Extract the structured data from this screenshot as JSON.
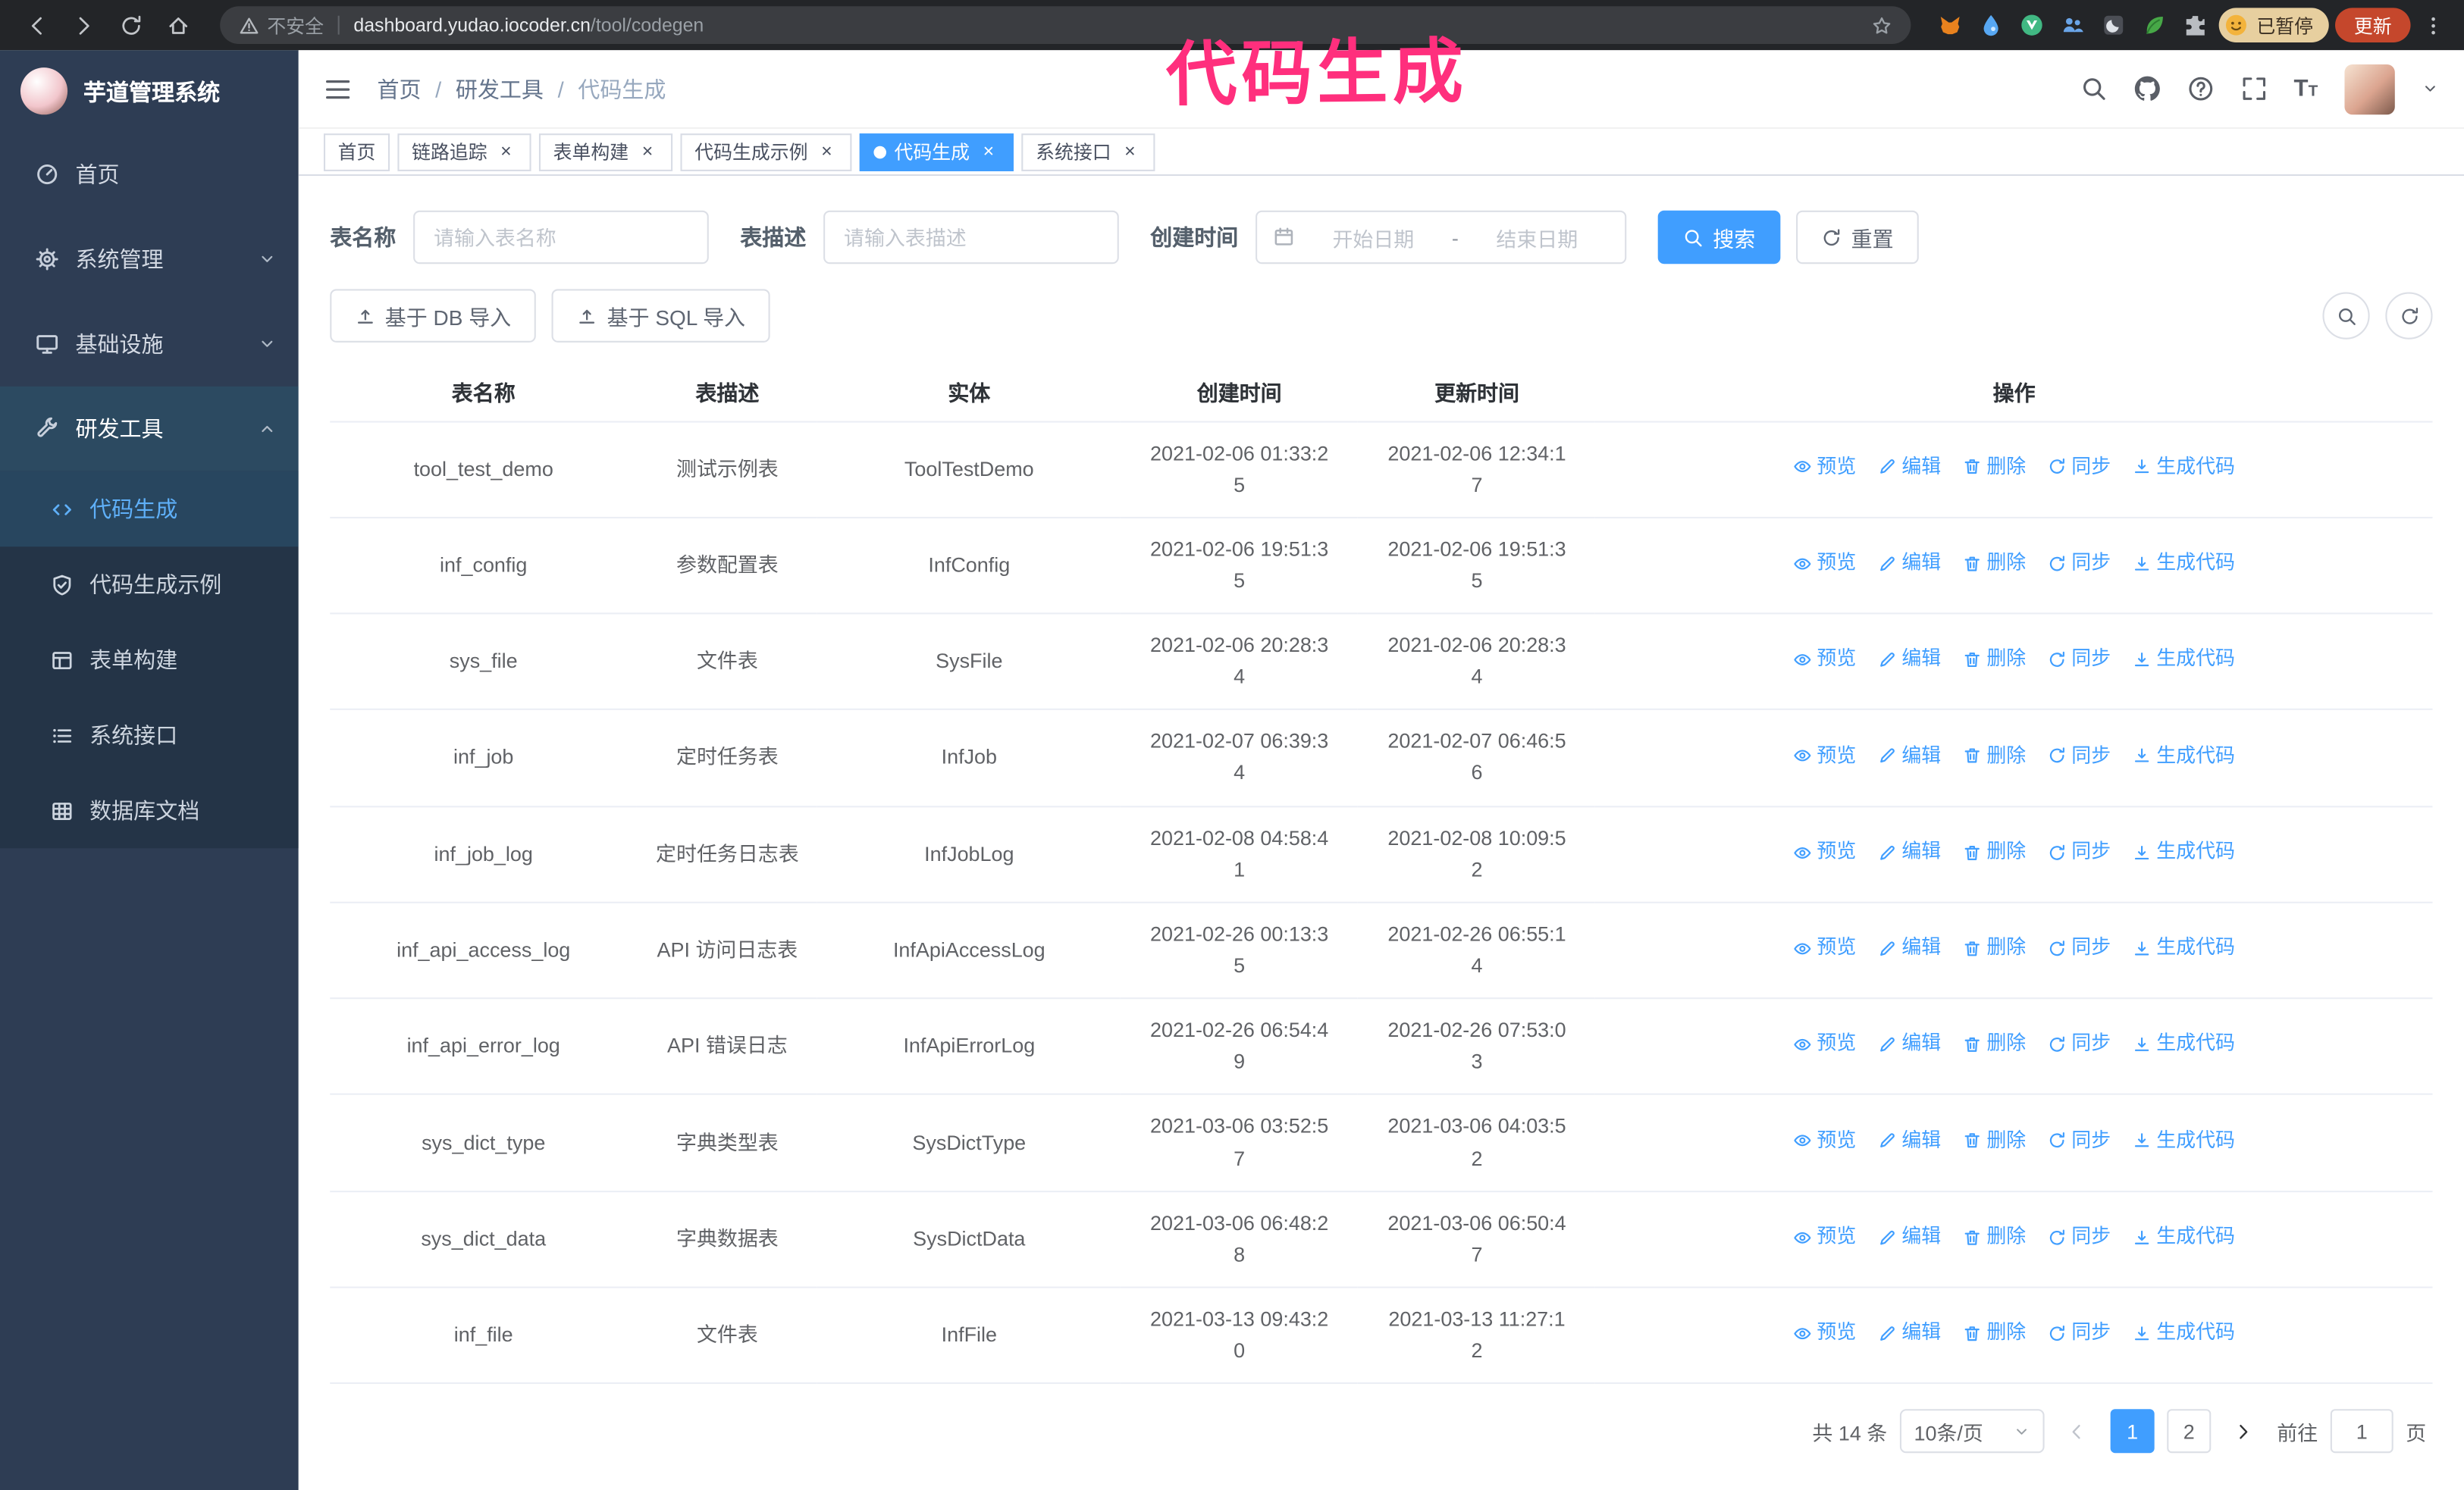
{
  "annotation": {
    "text": "代码生成",
    "color": "#ff2f7d"
  },
  "browser": {
    "security_label": "不安全",
    "url_host": "dashboard.yudao.iocoder.cn",
    "url_path": "/tool/codegen",
    "paused_badge": "已暂停",
    "update_button": "更新"
  },
  "sidebar": {
    "logo_title": "芋道管理系统",
    "items": [
      {
        "label": "首页",
        "icon": "gauge"
      },
      {
        "label": "系统管理",
        "icon": "gear",
        "chevron": "down"
      },
      {
        "label": "基础设施",
        "icon": "monitor",
        "chevron": "down"
      },
      {
        "label": "研发工具",
        "icon": "tool",
        "chevron": "up",
        "expanded": true,
        "children": [
          {
            "label": "代码生成",
            "icon": "code",
            "active": true
          },
          {
            "label": "代码生成示例",
            "icon": "shield"
          },
          {
            "label": "表单构建",
            "icon": "form"
          },
          {
            "label": "系统接口",
            "icon": "list"
          },
          {
            "label": "数据库文档",
            "icon": "grid"
          }
        ]
      }
    ]
  },
  "header": {
    "breadcrumb": [
      "首页",
      "研发工具",
      "代码生成"
    ],
    "separator": "/"
  },
  "tabs": [
    {
      "label": "首页",
      "closable": false,
      "active": false
    },
    {
      "label": "链路追踪",
      "closable": true,
      "active": false
    },
    {
      "label": "表单构建",
      "closable": true,
      "active": false
    },
    {
      "label": "代码生成示例",
      "closable": true,
      "active": false
    },
    {
      "label": "代码生成",
      "closable": true,
      "active": true
    },
    {
      "label": "系统接口",
      "closable": true,
      "active": false
    }
  ],
  "filters": {
    "table_name_label": "表名称",
    "table_name_placeholder": "请输入表名称",
    "table_desc_label": "表描述",
    "table_desc_placeholder": "请输入表描述",
    "create_time_label": "创建时间",
    "date_start_placeholder": "开始日期",
    "date_separator": "-",
    "date_end_placeholder": "结束日期",
    "search_button": "搜索",
    "reset_button": "重置"
  },
  "toolbar": {
    "import_db": "基于 DB 导入",
    "import_sql": "基于 SQL 导入"
  },
  "table": {
    "columns": [
      "表名称",
      "表描述",
      "实体",
      "创建时间",
      "更新时间",
      "操作"
    ],
    "actions": [
      "预览",
      "编辑",
      "删除",
      "同步",
      "生成代码"
    ],
    "action_icons": [
      "eye",
      "edit",
      "delete",
      "sync",
      "download"
    ],
    "rows": [
      {
        "name": "tool_test_demo",
        "desc": "测试示例表",
        "entity": "ToolTestDemo",
        "created": "2021-02-06 01:33:25",
        "updated": "2021-02-06 12:34:17"
      },
      {
        "name": "inf_config",
        "desc": "参数配置表",
        "entity": "InfConfig",
        "created": "2021-02-06 19:51:35",
        "updated": "2021-02-06 19:51:35"
      },
      {
        "name": "sys_file",
        "desc": "文件表",
        "entity": "SysFile",
        "created": "2021-02-06 20:28:34",
        "updated": "2021-02-06 20:28:34"
      },
      {
        "name": "inf_job",
        "desc": "定时任务表",
        "entity": "InfJob",
        "created": "2021-02-07 06:39:34",
        "updated": "2021-02-07 06:46:56"
      },
      {
        "name": "inf_job_log",
        "desc": "定时任务日志表",
        "entity": "InfJobLog",
        "created": "2021-02-08 04:58:41",
        "updated": "2021-02-08 10:09:52"
      },
      {
        "name": "inf_api_access_log",
        "desc": "API 访问日志表",
        "entity": "InfApiAccessLog",
        "created": "2021-02-26 00:13:35",
        "updated": "2021-02-26 06:55:14"
      },
      {
        "name": "inf_api_error_log",
        "desc": "API 错误日志",
        "entity": "InfApiErrorLog",
        "created": "2021-02-26 06:54:49",
        "updated": "2021-02-26 07:53:03"
      },
      {
        "name": "sys_dict_type",
        "desc": "字典类型表",
        "entity": "SysDictType",
        "created": "2021-03-06 03:52:57",
        "updated": "2021-03-06 04:03:52"
      },
      {
        "name": "sys_dict_data",
        "desc": "字典数据表",
        "entity": "SysDictData",
        "created": "2021-03-06 06:48:28",
        "updated": "2021-03-06 06:50:47"
      },
      {
        "name": "inf_file",
        "desc": "文件表",
        "entity": "InfFile",
        "created": "2021-03-13 09:43:20",
        "updated": "2021-03-13 11:27:12"
      }
    ]
  },
  "pagination": {
    "total_text": "共 14 条",
    "page_size": "10条/页",
    "pages": [
      "1",
      "2"
    ],
    "active_page": "1",
    "goto_label": "前往",
    "goto_value": "1",
    "goto_suffix": "页"
  },
  "colors": {
    "primary": "#409eff",
    "sidebar_bg": "#2e3d54"
  }
}
